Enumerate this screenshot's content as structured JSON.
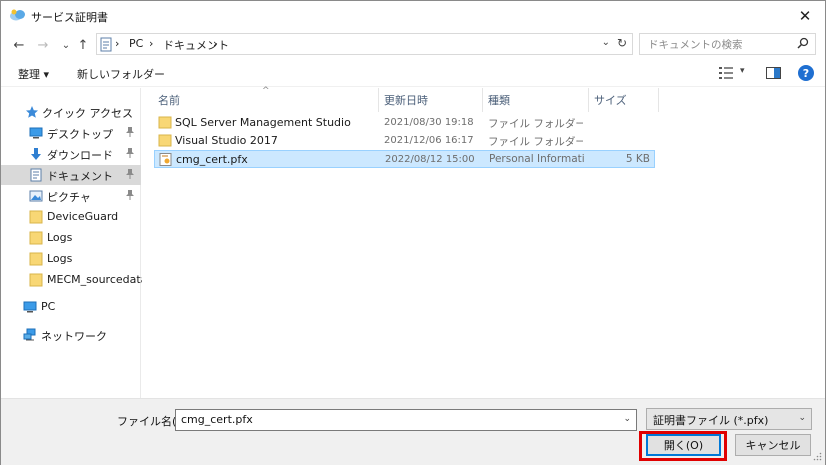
{
  "window": {
    "title": "サービス証明書",
    "close_glyph": "✕"
  },
  "nav": {
    "back_glyph": "←",
    "forward_glyph": "→",
    "recent_glyph": "⌄",
    "up_glyph": "↑",
    "breadcrumb": [
      "PC",
      "ドキュメント"
    ],
    "crumb_sep": "›",
    "address_dropdown_glyph": "⌄",
    "refresh_glyph": "↻",
    "search_placeholder": "ドキュメントの検索"
  },
  "toolbar": {
    "organize_label": "整理 ▾",
    "new_folder_label": "新しいフォルダー",
    "view_dropdown_glyph": "▾",
    "help_glyph": "?"
  },
  "sidebar": {
    "items": [
      {
        "label": "クイック アクセス",
        "icon": "star-icon",
        "pinned": false,
        "selected": false
      },
      {
        "label": "デスクトップ",
        "icon": "desktop-icon",
        "pinned": true,
        "selected": false
      },
      {
        "label": "ダウンロード",
        "icon": "download-icon",
        "pinned": true,
        "selected": false
      },
      {
        "label": "ドキュメント",
        "icon": "documents-icon",
        "pinned": true,
        "selected": true
      },
      {
        "label": "ピクチャ",
        "icon": "pictures-icon",
        "pinned": true,
        "selected": false
      },
      {
        "label": "DeviceGuard",
        "icon": "folder-icon",
        "pinned": false,
        "selected": false
      },
      {
        "label": "Logs",
        "icon": "folder-icon",
        "pinned": false,
        "selected": false
      },
      {
        "label": "Logs",
        "icon": "folder-icon",
        "pinned": false,
        "selected": false
      },
      {
        "label": "MECM_sourcedata",
        "icon": "folder-icon",
        "pinned": false,
        "selected": false
      },
      {
        "label": "PC",
        "icon": "pc-icon",
        "pinned": false,
        "selected": false
      },
      {
        "label": "ネットワーク",
        "icon": "network-icon",
        "pinned": false,
        "selected": false
      }
    ]
  },
  "filelist": {
    "columns": {
      "name": "名前",
      "modified": "更新日時",
      "type": "種類",
      "size": "サイズ"
    },
    "sort_glyph": "^",
    "rows": [
      {
        "name": "SQL Server Management Studio",
        "modified": "2021/08/30 19:18",
        "type": "ファイル フォルダー",
        "size": "",
        "icon": "folder-icon",
        "selected": false
      },
      {
        "name": "Visual Studio 2017",
        "modified": "2021/12/06 16:17",
        "type": "ファイル フォルダー",
        "size": "",
        "icon": "folder-icon",
        "selected": false
      },
      {
        "name": "cmg_cert.pfx",
        "modified": "2022/08/12 15:00",
        "type": "Personal Informati...",
        "size": "5 KB",
        "icon": "certificate-file-icon",
        "selected": true
      }
    ]
  },
  "footer": {
    "filename_label": "ファイル名(N):",
    "filename_value": "cmg_cert.pfx",
    "dropdown_glyph": "⌄",
    "filetype_value": "証明書ファイル (*.pfx)",
    "open_label": "開く(O)",
    "cancel_label": "キャンセル"
  },
  "colors": {
    "selection_bg": "#cce8ff",
    "selection_border": "#99d1ff",
    "folder_yellow": "#f8d775",
    "accent_blue": "#0078d7",
    "highlight_red": "#e00000"
  }
}
